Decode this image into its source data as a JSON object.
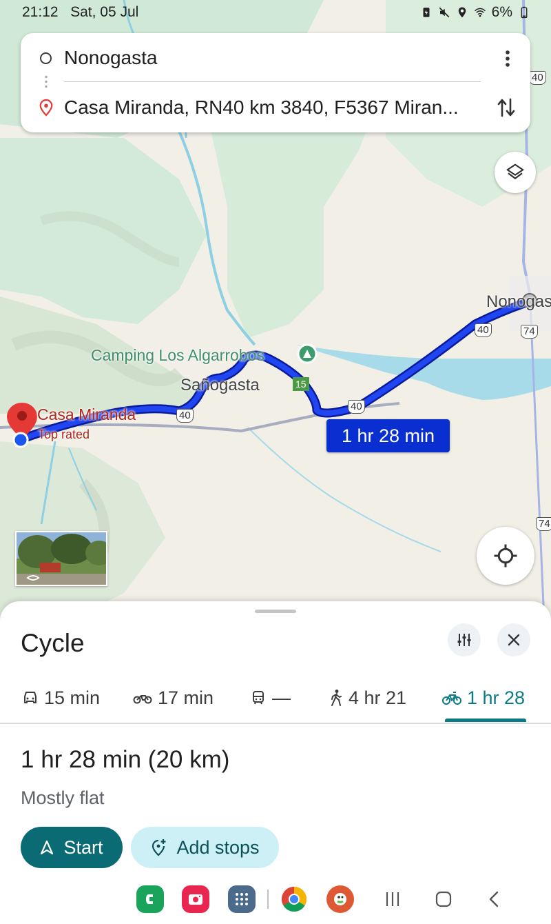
{
  "status_bar": {
    "time": "21:12",
    "date": "Sat, 05 Jul",
    "battery": "6%"
  },
  "search": {
    "origin": "Nonogasta",
    "destination": "Casa Miranda, RN40 km 3840, F5367 Miran..."
  },
  "map": {
    "labels": {
      "camping": "Camping Los Algarrobos",
      "town1": "Sañogasta",
      "town2": "Nonogas",
      "dest_name": "Casa Miranda",
      "dest_tag": "Top rated"
    },
    "shields": {
      "r40_a": "40",
      "r40_b": "40",
      "r40_c": "40",
      "r40_top": "40",
      "r74_a": "74",
      "r74_b": "74",
      "r15": "15"
    },
    "route_chip": "1 hr 28 min",
    "colors": {
      "route": "#0a2fd1",
      "route_border": "#0a1a9a",
      "water": "#9fd8e9",
      "land": "#f1efe6",
      "green": "#cfe9d6"
    }
  },
  "sheet": {
    "title": "Cycle",
    "modes": [
      {
        "icon": "car-icon",
        "label": "15 min"
      },
      {
        "icon": "motorbike-icon",
        "label": "17 min"
      },
      {
        "icon": "transit-icon",
        "label": "—"
      },
      {
        "icon": "walk-icon",
        "label": "4 hr 21"
      },
      {
        "icon": "bike-icon",
        "label": "1 hr 28"
      }
    ],
    "summary": "1 hr 28 min (20 km)",
    "subtitle": "Mostly flat",
    "start_label": "Start",
    "add_stops_label": "Add stops",
    "accent": "#0b7a84"
  }
}
